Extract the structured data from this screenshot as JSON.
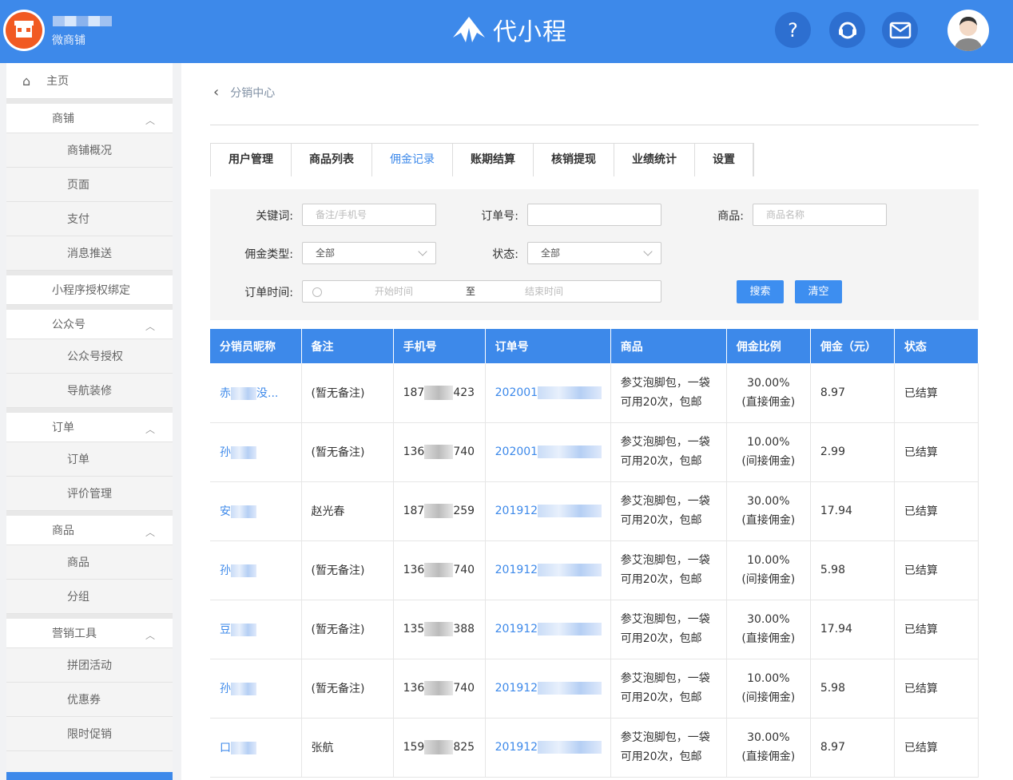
{
  "header": {
    "shop_sub": "微商铺",
    "brand": "代小程",
    "icons": [
      "help-icon",
      "support-icon",
      "mail-icon"
    ]
  },
  "sidebar": {
    "items": [
      {
        "label": "主页",
        "type": "home"
      },
      {
        "label": "商铺",
        "type": "group"
      },
      {
        "label": "商铺概况",
        "type": "sub"
      },
      {
        "label": "页面",
        "type": "sub"
      },
      {
        "label": "支付",
        "type": "sub"
      },
      {
        "label": "消息推送",
        "type": "sub"
      },
      {
        "label": "小程序授权绑定",
        "type": "group-noarrow"
      },
      {
        "label": "公众号",
        "type": "group"
      },
      {
        "label": "公众号授权",
        "type": "sub"
      },
      {
        "label": "导航装修",
        "type": "sub"
      },
      {
        "label": "订单",
        "type": "group"
      },
      {
        "label": "订单",
        "type": "sub"
      },
      {
        "label": "评价管理",
        "type": "sub"
      },
      {
        "label": "商品",
        "type": "group"
      },
      {
        "label": "商品",
        "type": "sub"
      },
      {
        "label": "分组",
        "type": "sub"
      },
      {
        "label": "营销工具",
        "type": "group"
      },
      {
        "label": "拼团活动",
        "type": "sub"
      },
      {
        "label": "优惠券",
        "type": "sub"
      },
      {
        "label": "限时促销",
        "type": "sub"
      }
    ]
  },
  "breadcrumb": {
    "label": "分销中心"
  },
  "tabs": [
    "用户管理",
    "商品列表",
    "佣金记录",
    "账期结算",
    "核销提现",
    "业绩统计",
    "设置"
  ],
  "active_tab": "佣金记录",
  "filter": {
    "keyword_label": "关键词:",
    "keyword_placeholder": "备注/手机号",
    "order_label": "订单号:",
    "order_value": "",
    "product_label": "商品:",
    "product_placeholder": "商品名称",
    "type_label": "佣金类型:",
    "type_value": "全部",
    "status_label": "状态:",
    "status_value": "全部",
    "time_label": "订单时间:",
    "start_placeholder": "开始时间",
    "to": "至",
    "end_placeholder": "结束时间",
    "search_button": "搜索",
    "clear_button": "清空"
  },
  "table": {
    "headers": [
      "分销员昵称",
      "备注",
      "手机号",
      "订单号",
      "商品",
      "佣金比例",
      "佣金（元）",
      "状态"
    ],
    "rows": [
      {
        "nick": "赤",
        "nick_suffix": "没...",
        "note": "(暂无备注)",
        "phone_pre": "187",
        "phone_suf": "423",
        "order": "202001",
        "product1": "参艾泡脚包，一袋",
        "product2": "可用20次，包邮",
        "ratio": "30.00%",
        "ratio_type": "(直接佣金)",
        "amount": "8.97",
        "status": "已结算"
      },
      {
        "nick": "孙",
        "nick_suffix": "",
        "note": "(暂无备注)",
        "phone_pre": "136",
        "phone_suf": "740",
        "order": "202001",
        "product1": "参艾泡脚包，一袋",
        "product2": "可用20次，包邮",
        "ratio": "10.00%",
        "ratio_type": "(间接佣金)",
        "amount": "2.99",
        "status": "已结算"
      },
      {
        "nick": "安",
        "nick_suffix": "",
        "note": "赵光春",
        "phone_pre": "187",
        "phone_suf": "259",
        "order": "201912",
        "product1": "参艾泡脚包，一袋",
        "product2": "可用20次，包邮",
        "ratio": "30.00%",
        "ratio_type": "(直接佣金)",
        "amount": "17.94",
        "status": "已结算"
      },
      {
        "nick": "孙",
        "nick_suffix": "",
        "note": "(暂无备注)",
        "phone_pre": "136",
        "phone_suf": "740",
        "order": "201912",
        "product1": "参艾泡脚包，一袋",
        "product2": "可用20次，包邮",
        "ratio": "10.00%",
        "ratio_type": "(间接佣金)",
        "amount": "5.98",
        "status": "已结算"
      },
      {
        "nick": "豆",
        "nick_suffix": "",
        "note": "(暂无备注)",
        "phone_pre": "135",
        "phone_suf": "388",
        "order": "201912",
        "product1": "参艾泡脚包，一袋",
        "product2": "可用20次，包邮",
        "ratio": "30.00%",
        "ratio_type": "(直接佣金)",
        "amount": "17.94",
        "status": "已结算"
      },
      {
        "nick": "孙",
        "nick_suffix": "",
        "note": "(暂无备注)",
        "phone_pre": "136",
        "phone_suf": "740",
        "order": "201912",
        "product1": "参艾泡脚包，一袋",
        "product2": "可用20次，包邮",
        "ratio": "10.00%",
        "ratio_type": "(间接佣金)",
        "amount": "5.98",
        "status": "已结算"
      },
      {
        "nick": "口",
        "nick_suffix": "",
        "note": "张航",
        "phone_pre": "159",
        "phone_suf": "825",
        "order": "201912",
        "product1": "参艾泡脚包，一袋",
        "product2": "可用20次，包邮",
        "ratio": "30.00%",
        "ratio_type": "(直接佣金)",
        "amount": "8.97",
        "status": "已结算"
      }
    ]
  }
}
